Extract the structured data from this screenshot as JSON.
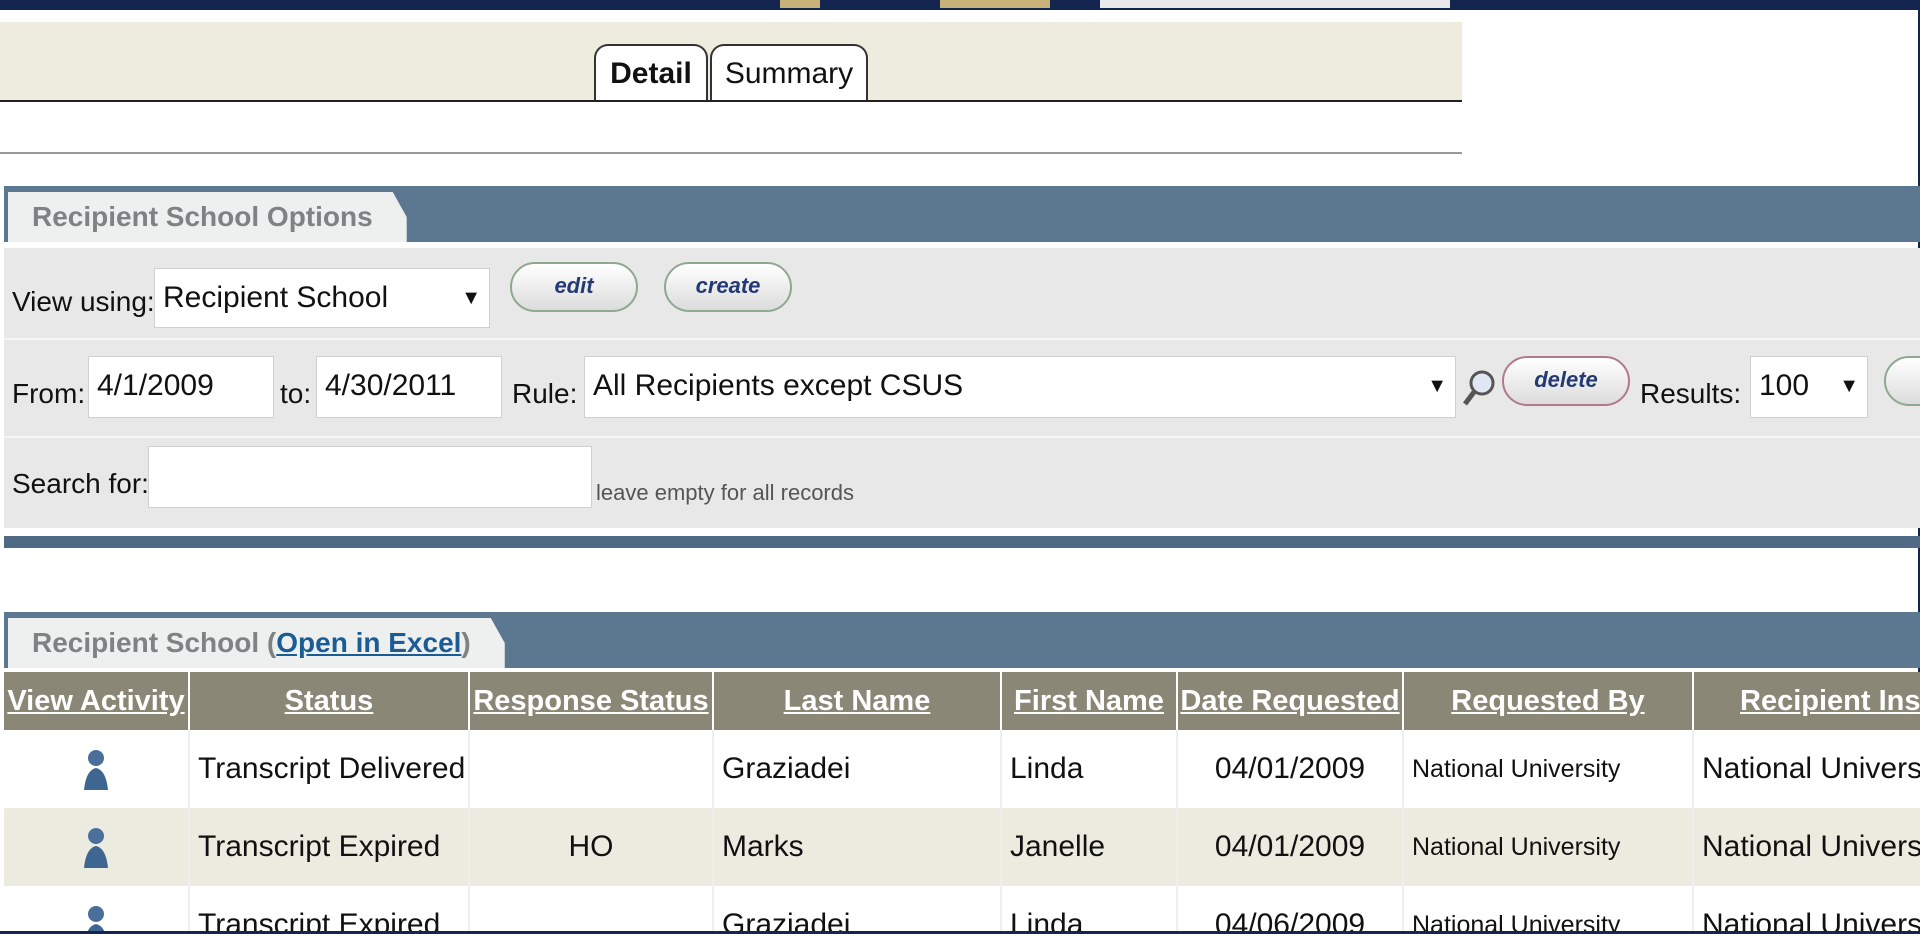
{
  "tabs": {
    "detail": "Detail",
    "summary": "Summary"
  },
  "options_section": {
    "title": "Recipient School Options"
  },
  "view_using": {
    "label": "View using:",
    "selected": "Recipient School",
    "edit_label": "edit",
    "create_label": "create"
  },
  "filters": {
    "from_label": "From:",
    "from_value": "4/1/2009",
    "to_label": "to:",
    "to_value": "4/30/2011",
    "rule_label": "Rule:",
    "rule_value": "All Recipients except CSUS",
    "delete_label": "delete",
    "results_label": "Results:",
    "results_value": "100"
  },
  "search": {
    "label": "Search for:",
    "value": "",
    "hint": "leave empty for all records"
  },
  "results_section": {
    "title_prefix": "Recipient School (",
    "link": "Open in Excel",
    "title_suffix": ")"
  },
  "table": {
    "columns": [
      "View Activity",
      "Status",
      "Response Status",
      "Last Name",
      "First Name",
      "Date Requested",
      "Requested By",
      "Recipient Institu"
    ],
    "rows": [
      {
        "status": "Transcript Delivered",
        "response": "",
        "last": "Graziadei",
        "first": "Linda",
        "date": "04/01/2009",
        "requested_by": "National University",
        "recipient": "National University"
      },
      {
        "status": "Transcript Expired",
        "response": "HO",
        "last": "Marks",
        "first": "Janelle",
        "date": "04/01/2009",
        "requested_by": "National University",
        "recipient": "National University"
      },
      {
        "status": "Transcript Expired",
        "response": "",
        "last": "Graziadei",
        "first": "Linda",
        "date": "04/06/2009",
        "requested_by": "National University",
        "recipient": "National University"
      }
    ]
  },
  "colors": {
    "section_bar": "#5c7891",
    "header_row": "#8a8776",
    "frame": "#14254f"
  }
}
